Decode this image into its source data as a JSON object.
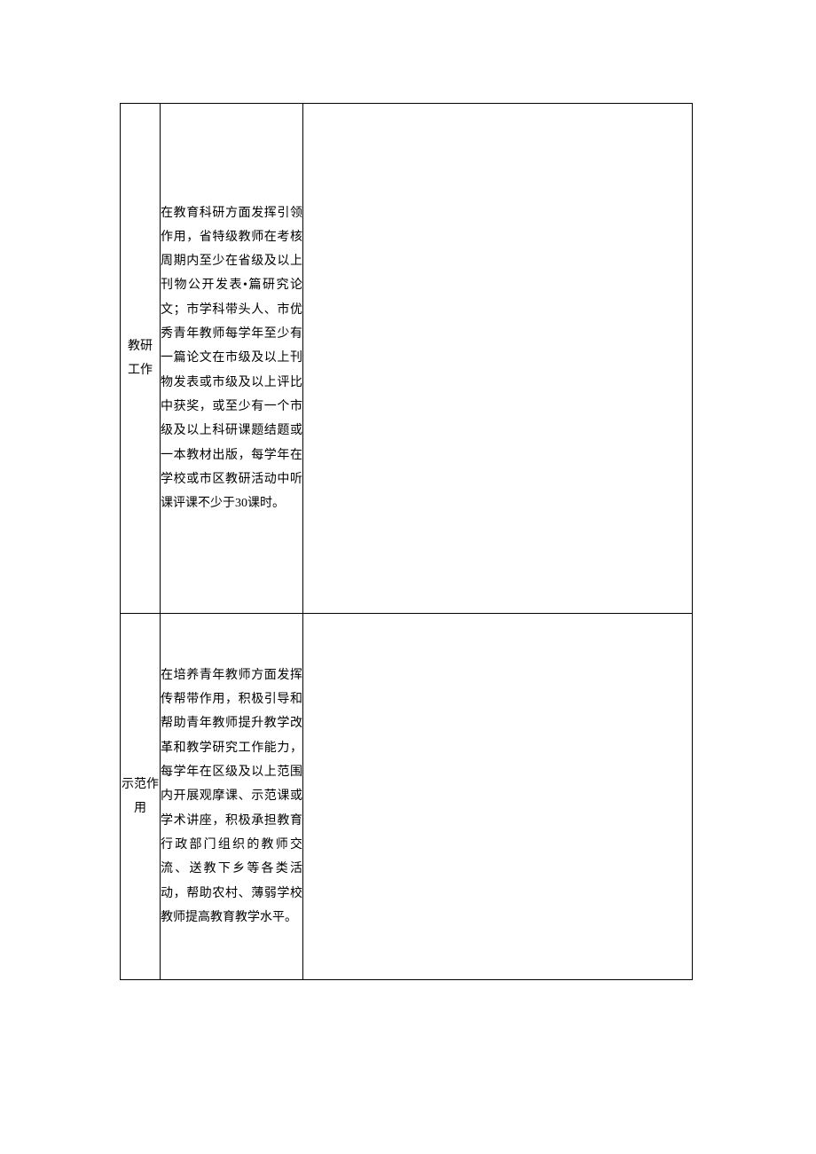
{
  "rows": [
    {
      "label_line1": "教研",
      "label_line2": "工作",
      "desc": "在教育科研方面发挥引领作用，省特级教师在考核周期内至少在省级及以上刊物公开发表•篇研究论文；市学科带头人、市优秀青年教师每学年至少有一篇论文在市级及以上刊物发表或市级及以上评比中获奖，或至少有一个市级及以上科研课题结题或一本教材出版，每学年在学校或市区教研活动中听课评课不少于30课时。"
    },
    {
      "label_line1": "示范作",
      "label_line2": "用",
      "desc": "在培养青年教师方面发挥传帮带作用，积极引导和帮助青年教师提升教学改革和教学研究工作能力，每学年在区级及以上范围内开展观摩课、示范课或学术讲座，积极承担教育行政部门组织的教师交流、送教下乡等各类活动，帮助农村、薄弱学校教师提高教育教学水平。"
    }
  ]
}
